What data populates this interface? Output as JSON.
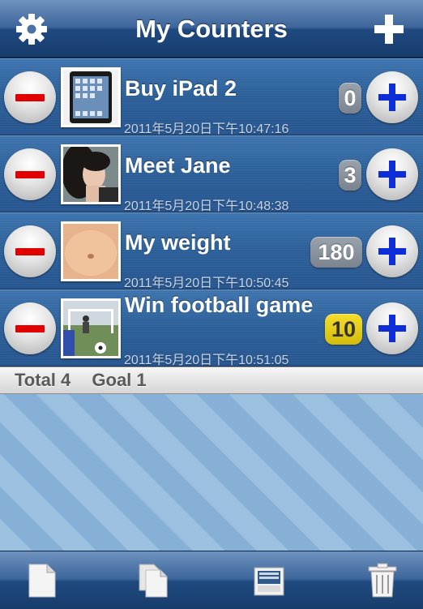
{
  "nav": {
    "title": "My Counters",
    "left_icon": "gear-icon",
    "right_icon": "plus-icon"
  },
  "counters": [
    {
      "name": "Buy iPad 2",
      "date": "2011年5月20日下午10:47:16",
      "count": "0",
      "goal_reached": false,
      "thumb": "ipad-photo"
    },
    {
      "name": "Meet Jane",
      "date": "2011年5月20日下午10:48:38",
      "count": "3",
      "goal_reached": false,
      "thumb": "portrait-photo"
    },
    {
      "name": "My weight",
      "date": "2011年5月20日下午10:50:45",
      "count": "180",
      "goal_reached": false,
      "thumb": "belly-photo"
    },
    {
      "name": "Win football game",
      "date": "2011年5月20日下午10:51:05",
      "count": "10",
      "goal_reached": true,
      "thumb": "football-photo"
    }
  ],
  "summary": {
    "total": "Total 4",
    "goal": "Goal 1"
  },
  "toolbar": {
    "icons": [
      "new-document-icon",
      "copy-documents-icon",
      "inbox-tray-icon",
      "trash-icon"
    ]
  },
  "colors": {
    "minus": "#e00000",
    "plus": "#0c2dd8",
    "goal_badge": "#f4de2a",
    "count_badge": "#8c959f"
  }
}
